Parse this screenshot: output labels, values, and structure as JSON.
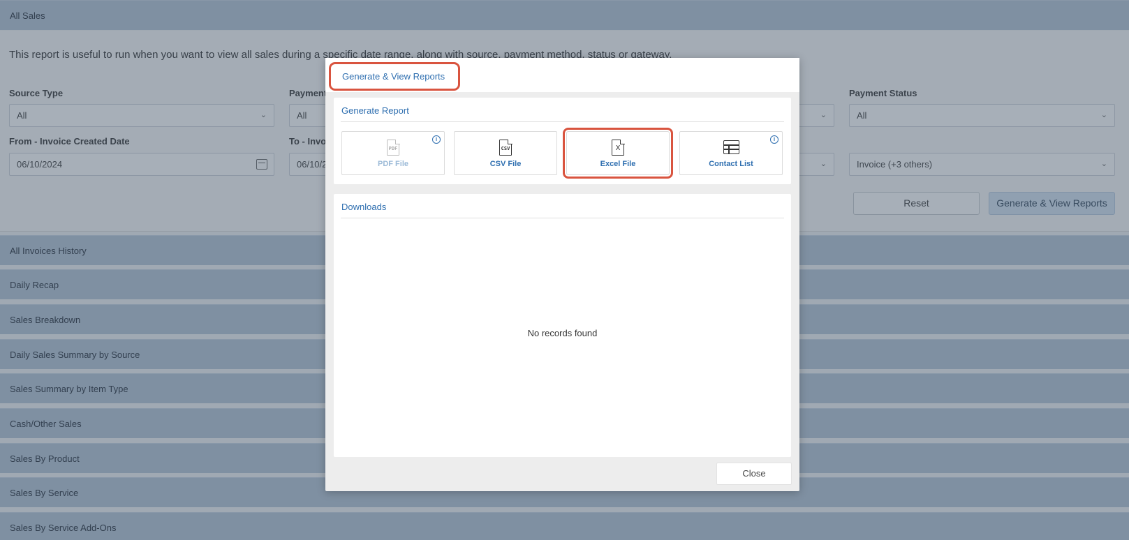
{
  "page": {
    "section_title": "All Sales",
    "description": "This report is useful to run when you want to view all sales during a specific date range, along with source, payment method, status or gateway.",
    "filters": {
      "source_type_label": "Source Type",
      "source_type_value": "All",
      "payment_method_label": "Payment",
      "payment_method_value": "All",
      "payment_status_label": "Payment Status",
      "payment_status_value": "All",
      "from_date_label": "From - Invoice Created Date",
      "from_date_value": "06/10/2024",
      "to_date_label": "To - Invo",
      "to_date_value": "06/10/2",
      "invoice_type_value": "Invoice (+3 others)"
    },
    "reset_label": "Reset",
    "generate_label": "Generate & View Reports",
    "other_sections": [
      "All Invoices History",
      "Daily Recap",
      "Sales Breakdown",
      "Daily Sales Summary by Source",
      "Sales Summary by Item Type",
      "Cash/Other Sales",
      "Sales By Product",
      "Sales By Service",
      "Sales By Service Add-Ons"
    ]
  },
  "modal": {
    "title": "Generate & View Reports",
    "generate_section_title": "Generate Report",
    "options": [
      {
        "label": "PDF File",
        "icon_text": "PDF",
        "icon": "pdf-file-icon",
        "disabled": true,
        "info": true
      },
      {
        "label": "CSV File",
        "icon_text": "CSV",
        "icon": "csv-file-icon",
        "disabled": false,
        "info": false
      },
      {
        "label": "Excel File",
        "icon_text": "X",
        "icon": "excel-file-icon",
        "disabled": false,
        "info": false,
        "highlighted": true
      },
      {
        "label": "Contact List",
        "icon": "table-icon",
        "disabled": false,
        "info": true
      }
    ],
    "info_glyph": "i",
    "downloads_title": "Downloads",
    "empty_text": "No records found",
    "close_label": "Close"
  },
  "colors": {
    "accent": "#2f6fb0",
    "highlight": "#d9543f",
    "section_bar": "#b7c7d8"
  }
}
